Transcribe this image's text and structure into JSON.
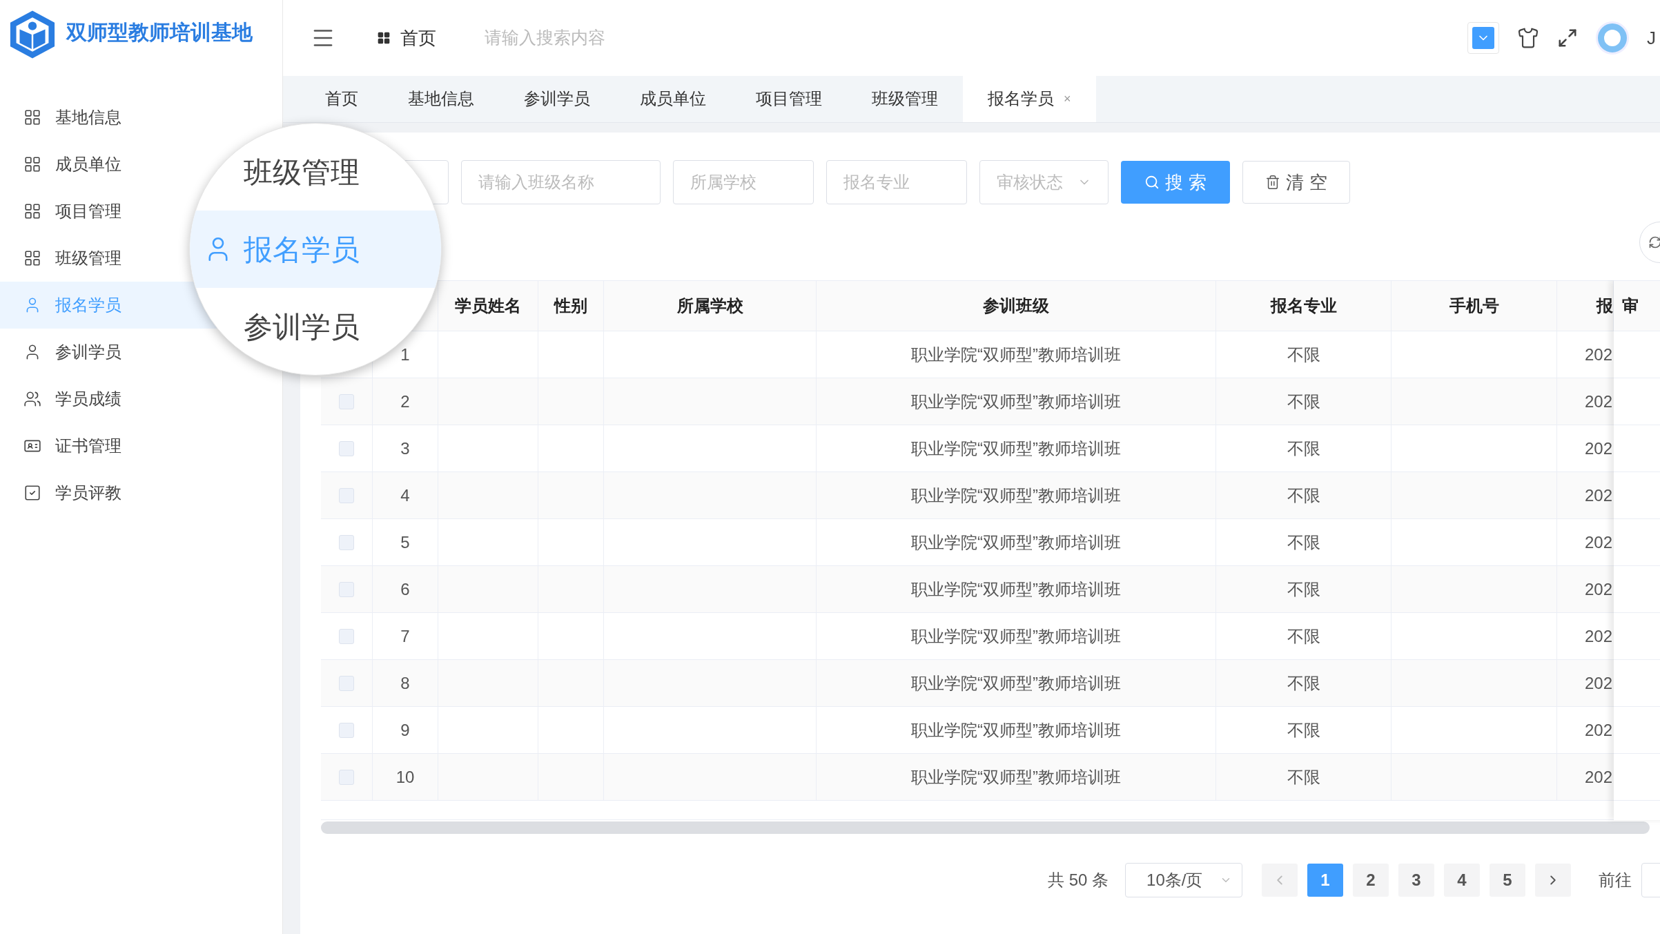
{
  "brand": {
    "title": "双师型教师培训基地"
  },
  "header": {
    "breadcrumb": "首页",
    "search": {
      "placeholder": "请输入搜索内容"
    },
    "user": "J"
  },
  "sidebar": {
    "items": [
      {
        "label": "基地信息",
        "selected": false
      },
      {
        "label": "成员单位",
        "selected": false
      },
      {
        "label": "项目管理",
        "selected": false
      },
      {
        "label": "班级管理",
        "selected": false
      },
      {
        "label": "报名学员",
        "selected": true
      },
      {
        "label": "参训学员",
        "selected": false
      },
      {
        "label": "学员成绩",
        "selected": false
      },
      {
        "label": "证书管理",
        "selected": false
      },
      {
        "label": "学员评教",
        "selected": false
      }
    ]
  },
  "magnifier": {
    "items": [
      {
        "label": "班级管理",
        "selected": false
      },
      {
        "label": "报名学员",
        "selected": true
      },
      {
        "label": "参训学员",
        "selected": false
      }
    ]
  },
  "tabs": [
    {
      "label": "首页",
      "selected": false
    },
    {
      "label": "基地信息",
      "selected": false
    },
    {
      "label": "参训学员",
      "selected": false
    },
    {
      "label": "成员单位",
      "selected": false
    },
    {
      "label": "项目管理",
      "selected": false
    },
    {
      "label": "班级管理",
      "selected": false
    },
    {
      "label": "报名学员",
      "selected": true,
      "close": "×"
    }
  ],
  "filters": [
    {
      "kind": "input"
    },
    {
      "kind": "input",
      "placeholder": "请输入班级名称"
    },
    {
      "kind": "input",
      "placeholder": "所属学校"
    },
    {
      "kind": "input",
      "placeholder": "报名专业"
    },
    {
      "kind": "select",
      "placeholder": "审核状态"
    }
  ],
  "buttons": [
    {
      "kind": "primary",
      "label": "搜 索"
    },
    {
      "kind": "plain",
      "label": "清 空"
    }
  ],
  "table": {
    "columns": [
      "",
      "",
      "学员姓名",
      "性别",
      "所属学校",
      "参训班级",
      "报名专业",
      "手机号",
      "报",
      "审"
    ],
    "rows": [
      {
        "index": "1",
        "class": "职业学院“双师型”教师培训班",
        "major": "不限",
        "date": "202"
      },
      {
        "checked": false,
        "index": "2",
        "class": "职业学院“双师型”教师培训班",
        "major": "不限",
        "date": "202"
      },
      {
        "checked": false,
        "index": "3",
        "class": "职业学院“双师型”教师培训班",
        "major": "不限",
        "date": "202"
      },
      {
        "checked": false,
        "index": "4",
        "class": "职业学院“双师型”教师培训班",
        "major": "不限",
        "date": "202"
      },
      {
        "checked": false,
        "index": "5",
        "class": "职业学院“双师型”教师培训班",
        "major": "不限",
        "date": "202"
      },
      {
        "checked": false,
        "index": "6",
        "class": "职业学院“双师型”教师培训班",
        "major": "不限",
        "date": "202"
      },
      {
        "checked": false,
        "index": "7",
        "class": "职业学院“双师型”教师培训班",
        "major": "不限",
        "date": "202"
      },
      {
        "checked": false,
        "index": "8",
        "class": "职业学院“双师型”教师培训班",
        "major": "不限",
        "date": "202"
      },
      {
        "checked": false,
        "index": "9",
        "class": "职业学院“双师型”教师培训班",
        "major": "不限",
        "date": "202"
      },
      {
        "checked": false,
        "index": "10",
        "class": "职业学院“双师型”教师培训班",
        "major": "不限",
        "date": "202"
      }
    ]
  },
  "pagination": {
    "total": "共 50 条",
    "page_size": "10条/页",
    "pages": [
      {
        "label": "1",
        "selected": true
      },
      {
        "label": "2",
        "selected": false
      },
      {
        "label": "3",
        "selected": false
      },
      {
        "label": "4",
        "selected": false
      },
      {
        "label": "5",
        "selected": false
      }
    ],
    "goto": "前往"
  }
}
